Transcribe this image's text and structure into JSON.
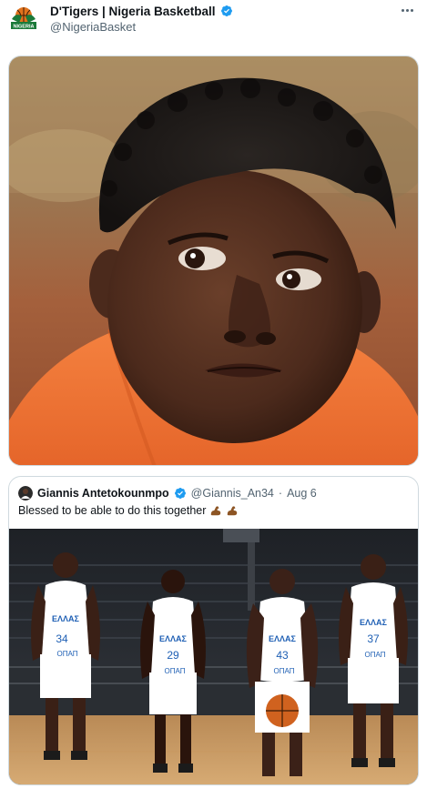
{
  "author": {
    "name": "D'Tigers | Nigeria Basketball",
    "handle": "@NigeriaBasket",
    "verified": true,
    "logo_text": "NIGERIA"
  },
  "menu": {
    "icon": "more-horizontal-icon"
  },
  "main_media": {
    "icon": "photo"
  },
  "quote": {
    "author_name": "Giannis Antetokounmpo",
    "handle": "@Giannis_An34",
    "separator": "·",
    "date": "Aug 6",
    "text": "Blessed to be able to do this together",
    "emojis": [
      "flexed-biceps-emoji",
      "flexed-biceps-emoji"
    ],
    "team_jersey_text": "ΕΛΛΑΣ",
    "sponsor_text": "OПАП",
    "jersey_numbers": [
      "34",
      "29",
      "43",
      "37"
    ]
  },
  "colors": {
    "verified": "#1d9bf0",
    "text_primary": "#0f1419",
    "text_secondary": "#536471",
    "border": "#cfd9de",
    "jersey_blue": "#1e5fb4"
  }
}
